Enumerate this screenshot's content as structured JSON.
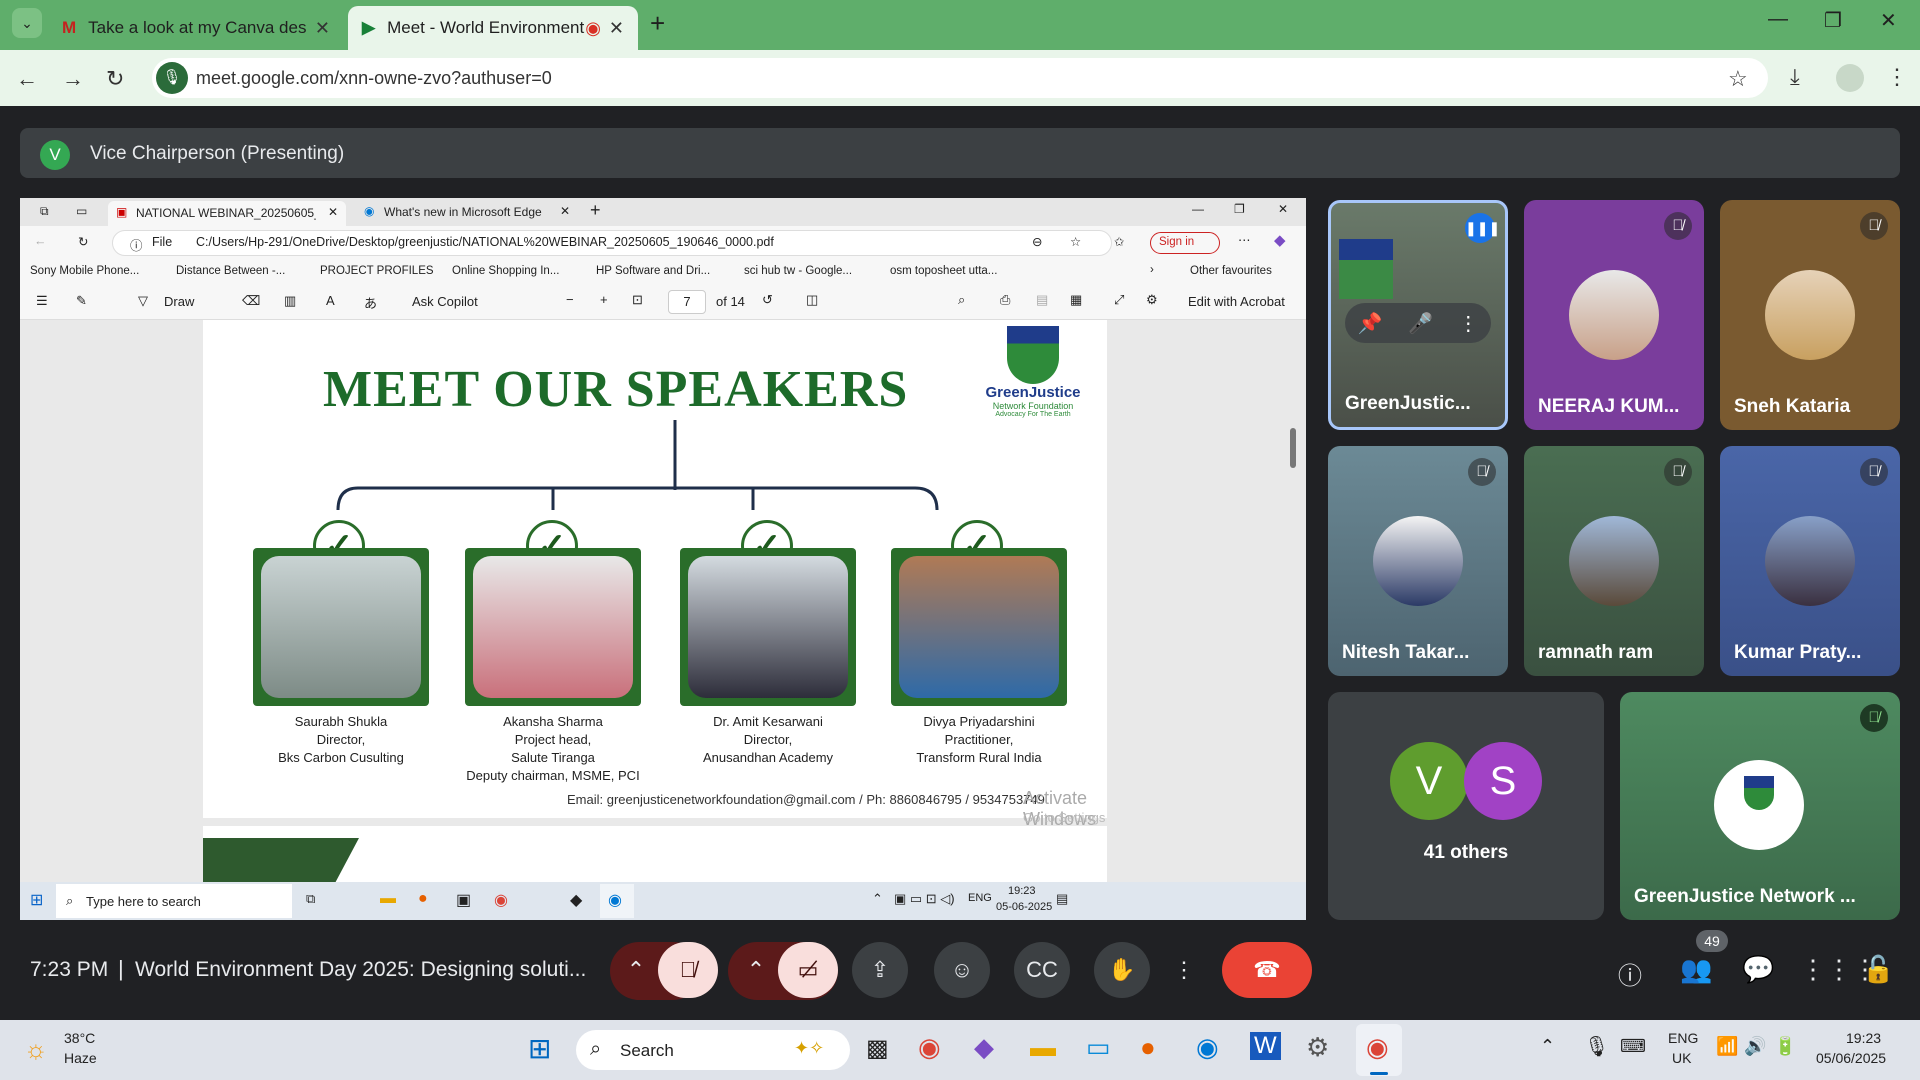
{
  "browser": {
    "tabs": [
      {
        "label": "Take a look at my Canva design"
      },
      {
        "label": "Meet - World Environment"
      }
    ],
    "url": "meet.google.com/xnn-owne-zvo?authuser=0"
  },
  "meet": {
    "presenter_initial": "V",
    "presenter_label": "Vice Chairperson (Presenting)",
    "time": "7:23 PM",
    "separator": "|",
    "title": "World Environment Day 2025: Designing soluti...",
    "people_count": "49",
    "others_label": "41 others",
    "others_initials": [
      "V",
      "S"
    ],
    "participants": [
      {
        "name": "GreenJustic..."
      },
      {
        "name": "NEERAJ KUM..."
      },
      {
        "name": "Sneh Kataria"
      },
      {
        "name": "Nitesh Takar..."
      },
      {
        "name": "ramnath ram"
      },
      {
        "name": "Kumar Praty..."
      },
      {
        "name": "GreenJustice Network ..."
      }
    ]
  },
  "shared": {
    "edge_tabs": [
      "NATIONAL WEBINAR_20250605_",
      "What's new in Microsoft Edge"
    ],
    "file_label": "File",
    "path": "C:/Users/Hp-291/OneDrive/Desktop/greenjustic/NATIONAL%20WEBINAR_20250605_190646_0000.pdf",
    "sign_in": "Sign in",
    "bookmarks": [
      "Sony Mobile Phone...",
      "Distance Between -...",
      "PROJECT PROFILES",
      "Online Shopping In...",
      "HP Software and Dri...",
      "sci hub tw - Google...",
      "osm toposheet utta..."
    ],
    "other_favourites": "Other favourites",
    "draw": "Draw",
    "ask_copilot": "Ask Copilot",
    "page": "7",
    "page_of": "of 14",
    "edit_acrobat": "Edit with Acrobat",
    "slide_title": "MEET OUR SPEAKERS",
    "logo_name": "GreenJustice",
    "logo_sub": "Network Foundation",
    "logo_tag": "Advocacy For The Earth",
    "speakers": [
      {
        "name": "Saurabh Shukla",
        "l1": "Director,",
        "l2": "Bks Carbon Cusulting",
        "l3": ""
      },
      {
        "name": "Akansha Sharma",
        "l1": "Project head,",
        "l2": "Salute Tiranga",
        "l3": "Deputy chairman, MSME, PCI"
      },
      {
        "name": "Dr. Amit Kesarwani",
        "l1": "Director,",
        "l2": "Anusandhan Academy",
        "l3": ""
      },
      {
        "name": "Divya Priyadarshini",
        "l1": "Practitioner,",
        "l2": "Transform Rural India",
        "l3": ""
      }
    ],
    "email": "Email: greenjusticenetworkfoundation@gmail.com / Ph: 8860846795 / 9534753749",
    "watermark": "Activate Windows",
    "watermark2": "Go to Settings to activate Windows.",
    "taskbar_search": "Type here to search",
    "lang": "ENG",
    "clock_time": "19:23",
    "clock_date": "05-06-2025"
  },
  "taskbar": {
    "temp": "38°C",
    "weather": "Haze",
    "search": "Search",
    "lang1": "ENG",
    "lang2": "UK",
    "time": "19:23",
    "date": "05/06/2025"
  },
  "colors": {
    "meet_bg": "#202124",
    "tab_bar": "#5fae6b",
    "end_call": "#ea4335",
    "slide_green": "#1d6b2a"
  }
}
